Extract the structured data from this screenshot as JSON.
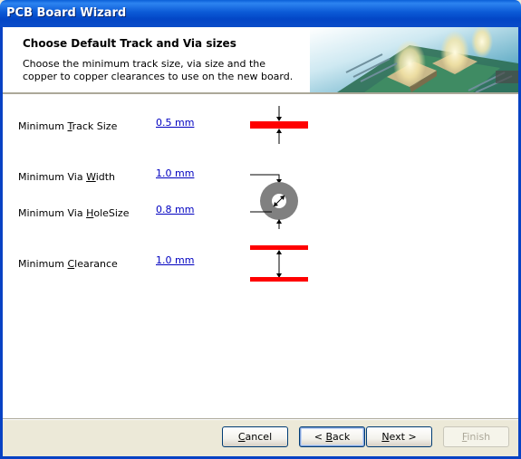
{
  "window": {
    "title": "PCB Board Wizard"
  },
  "header": {
    "title": "Choose Default Track and Via sizes",
    "description": "Choose the minimum track size, via size and the copper to copper clearances to use on the new board."
  },
  "rows": [
    {
      "label_pre": "Minimum ",
      "label_mnemonic": "T",
      "label_post": "rack Size",
      "value": "0.5 mm"
    },
    {
      "label_pre": "Minimum Via ",
      "label_mnemonic": "W",
      "label_post": "idth",
      "value": "1.0 mm"
    },
    {
      "label_pre": "Minimum Via ",
      "label_mnemonic": "H",
      "label_post": "oleSize",
      "value": "0.8 mm"
    },
    {
      "label_pre": "Minimum ",
      "label_mnemonic": "C",
      "label_post": "learance",
      "value": "1.0 mm"
    }
  ],
  "buttons": {
    "cancel": {
      "pre": "",
      "mnemonic": "C",
      "post": "ancel"
    },
    "back": {
      "pre": "< ",
      "mnemonic": "B",
      "post": "ack"
    },
    "next": {
      "pre": "",
      "mnemonic": "N",
      "post": "ext >"
    },
    "finish": {
      "pre": "",
      "mnemonic": "F",
      "post": "inish"
    }
  },
  "colors": {
    "track": "#ff0000",
    "via": "#808080",
    "link": "#0000c0",
    "titlebar": "#0a5fd8"
  }
}
